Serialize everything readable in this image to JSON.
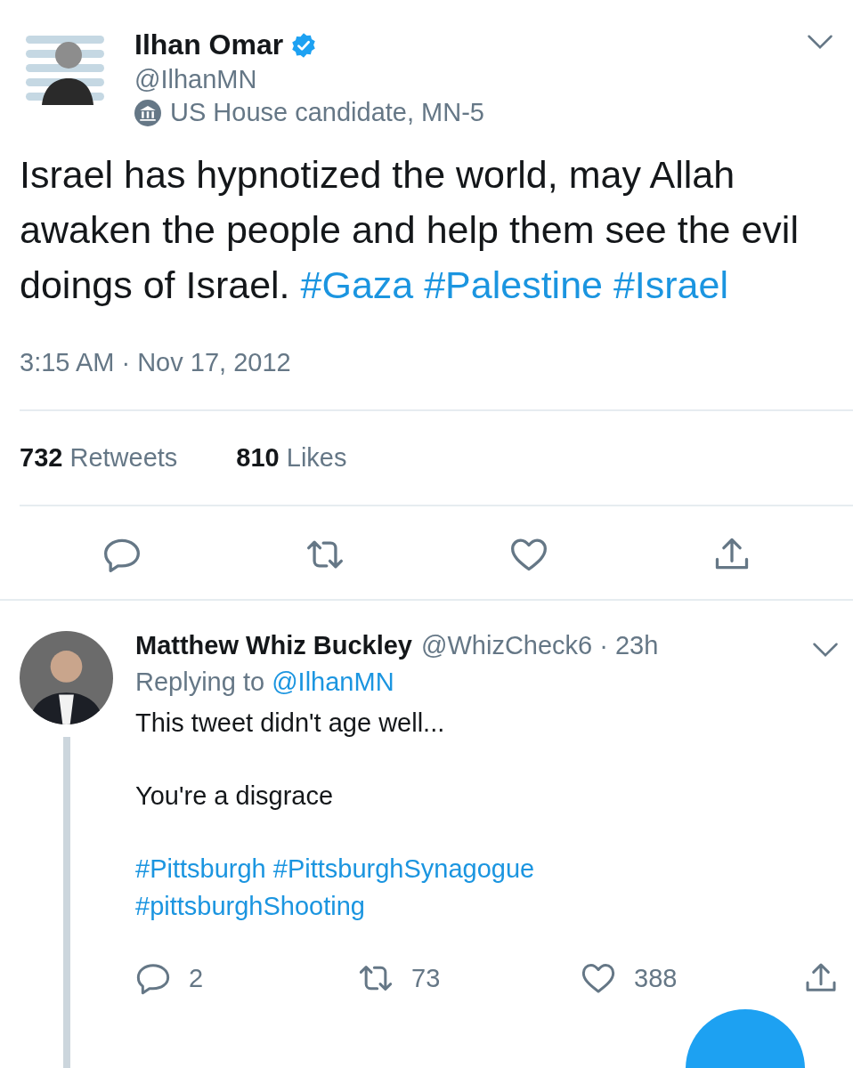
{
  "tweet": {
    "author": {
      "name": "Ilhan Omar",
      "verified": true,
      "handle": "@IlhanMN",
      "label": "US House candidate, MN-5"
    },
    "text": [
      {
        "kind": "plain",
        "text": "Israel has hypnotized the world, may Allah awaken the people and help them see the evil doings of Israel."
      },
      {
        "kind": "hashtag",
        "text": "#Gaza"
      },
      {
        "kind": "hashtag",
        "text": "#Palestine"
      },
      {
        "kind": "hashtag",
        "text": "#Israel"
      }
    ],
    "timestamp": "3:15 AM · Nov 17, 2012",
    "stats": [
      {
        "count": "732",
        "label": "Retweets"
      },
      {
        "count": "810",
        "label": "Likes"
      }
    ]
  },
  "reply": {
    "name": "Matthew Whiz Buckley",
    "handle": "@WhizCheck6",
    "time": "· 23h",
    "replying_prefix": "Replying to",
    "replying_handle": "@IlhanMN",
    "paragraphs": [
      [
        {
          "kind": "plain",
          "text": "This tweet didn't age well..."
        }
      ],
      [
        {
          "kind": "plain",
          "text": "You're a disgrace"
        }
      ],
      [
        {
          "kind": "hashtag",
          "text": "#Pittsburgh"
        },
        {
          "kind": "hashtag",
          "text": "#PittsburghSynagogue"
        },
        {
          "kind": "hashtag",
          "text": "#pittsburghShooting"
        }
      ]
    ],
    "actions": [
      {
        "kind": "reply",
        "count": "2"
      },
      {
        "kind": "retweet",
        "count": "73"
      },
      {
        "kind": "like",
        "count": "388"
      },
      {
        "kind": "share"
      }
    ]
  }
}
